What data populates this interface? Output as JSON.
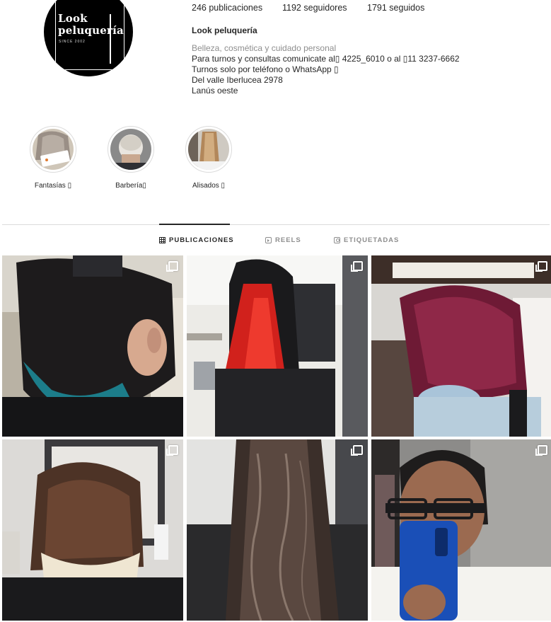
{
  "profile": {
    "logo_line1": "Look",
    "logo_line2": "peluquería",
    "logo_since": "SINCE 2002",
    "stats": [
      {
        "value": "246",
        "label": "publicaciones"
      },
      {
        "value": "1192",
        "label": "seguidores"
      },
      {
        "value": "1791",
        "label": "seguidos"
      }
    ],
    "name": "Look peluquería",
    "category": "Belleza, cosmética y cuidado personal",
    "bio_lines": [
      "Para turnos y consultas comunicate al▯ 4225_6010 o al ▯11 3237-6662",
      "Turnos solo por teléfono o WhatsApp ▯",
      "Del valle Iberlucea 2978",
      "Lanús oeste"
    ]
  },
  "highlights": [
    {
      "label": "Fantasías ▯"
    },
    {
      "label": "Barbería▯"
    },
    {
      "label": "Alisados ▯"
    }
  ],
  "tabs": [
    {
      "label": "PUBLICACIONES",
      "icon": "grid-icon",
      "active": true
    },
    {
      "label": "REELS",
      "icon": "reels-icon",
      "active": false
    },
    {
      "label": "ETIQUETADAS",
      "icon": "tagged-icon",
      "active": false
    }
  ],
  "posts": [
    {
      "name": "post-teal-tips",
      "icon": "multiple-photos-icon"
    },
    {
      "name": "post-red-panels",
      "icon": "multiple-photos-icon"
    },
    {
      "name": "post-burgundy-bob",
      "icon": "multiple-photos-icon"
    },
    {
      "name": "post-short-brown",
      "icon": "multiple-photos-icon"
    },
    {
      "name": "post-long-waves",
      "icon": "multiple-photos-icon"
    },
    {
      "name": "post-mirror-selfie",
      "icon": "multiple-photos-icon"
    }
  ],
  "colors": {
    "text": "#262626",
    "muted": "#8e8e8e",
    "border": "#dbdbdb"
  }
}
